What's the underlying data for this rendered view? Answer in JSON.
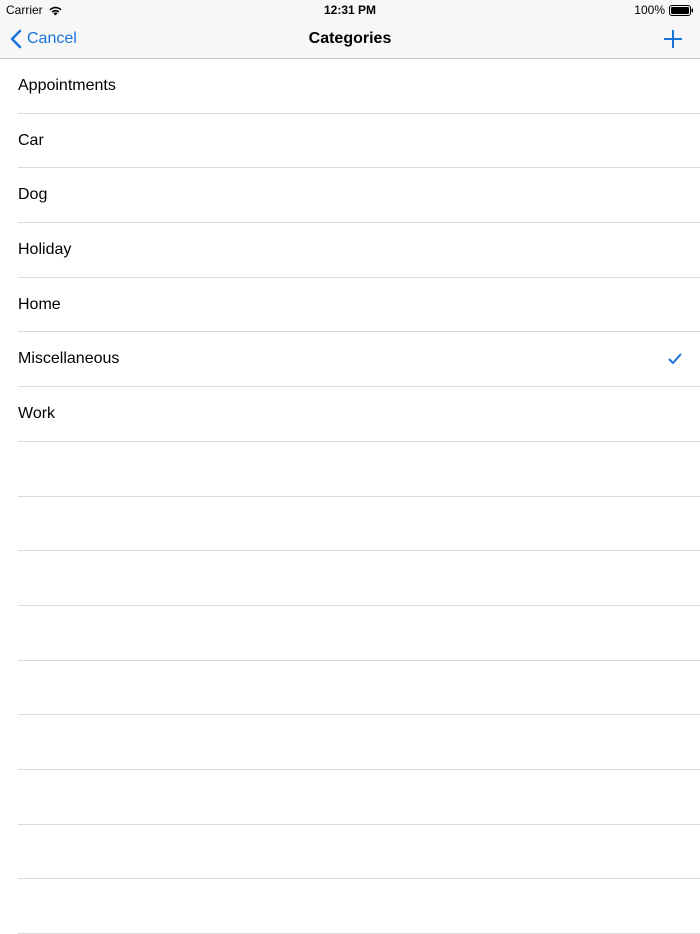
{
  "status_bar": {
    "carrier": "Carrier",
    "time": "12:31 PM",
    "battery": "100%"
  },
  "nav": {
    "back_label": "Cancel",
    "title": "Categories",
    "add_icon": "plus-icon",
    "back_icon": "chevron-left-icon"
  },
  "categories": [
    {
      "label": "Appointments",
      "selected": false
    },
    {
      "label": "Car",
      "selected": false
    },
    {
      "label": "Dog",
      "selected": false
    },
    {
      "label": "Holiday",
      "selected": false
    },
    {
      "label": "Home",
      "selected": false
    },
    {
      "label": "Miscellaneous",
      "selected": true
    },
    {
      "label": "Work",
      "selected": false
    }
  ],
  "empty_row_count": 9,
  "colors": {
    "accent": "#1a73d9",
    "bar_background": "#f7f7f7",
    "separator": "#d9d9de"
  }
}
